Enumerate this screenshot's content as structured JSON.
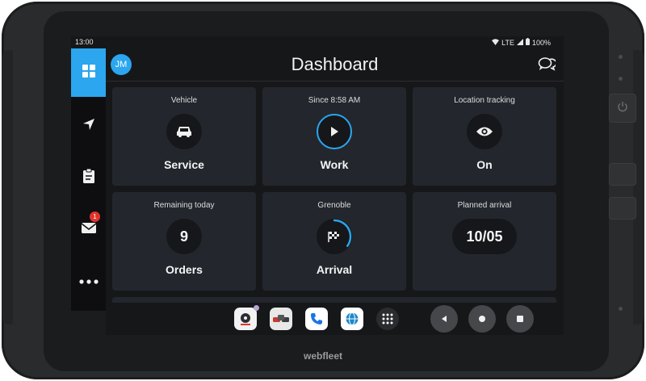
{
  "status_bar": {
    "time": "13:00",
    "network": "LTE",
    "battery": "100%",
    "icons": [
      "wifi-icon",
      "signal-icon",
      "battery-icon"
    ]
  },
  "header": {
    "title": "Dashboard",
    "avatar_initials": "JM",
    "chat_icon": "chat-bubbles-icon"
  },
  "sidebar": {
    "items": [
      {
        "name": "dashboard",
        "icon": "grid-icon",
        "active": true
      },
      {
        "name": "navigation",
        "icon": "navigation-arrow-icon",
        "active": false
      },
      {
        "name": "tasks",
        "icon": "clipboard-icon",
        "active": false
      },
      {
        "name": "messages",
        "icon": "mail-icon",
        "active": false,
        "badge": "1"
      },
      {
        "name": "more",
        "icon": "more-dots-icon",
        "active": false
      }
    ]
  },
  "tiles": [
    {
      "label": "Vehicle",
      "value": "Service",
      "icon": "car-icon"
    },
    {
      "label": "Since 8:58 AM",
      "value": "Work",
      "icon": "play-icon"
    },
    {
      "label": "Location tracking",
      "value": "On",
      "icon": "eye-icon"
    },
    {
      "label": "Remaining today",
      "number": "9",
      "value": "Orders"
    },
    {
      "label": "Grenoble",
      "value": "Arrival",
      "icon": "checkered-flag-icon",
      "progress": 0.35
    },
    {
      "label": "Planned arrival",
      "pill": "10/05"
    }
  ],
  "dock_apps": [
    "webfleet-app-icon",
    "vehicles-app-icon",
    "phone-app-icon",
    "browser-app-icon",
    "apps-grid-icon"
  ],
  "dock_apps_labels": {
    "webfleet": "webfleet"
  },
  "nav_buttons": [
    "back-icon",
    "home-icon",
    "recents-icon"
  ],
  "device_brand": "webfleet",
  "colors": {
    "accent": "#2ba6ef",
    "tile_bg": "#23272d",
    "screen_bg": "#161719",
    "badge": "#e2342d"
  }
}
